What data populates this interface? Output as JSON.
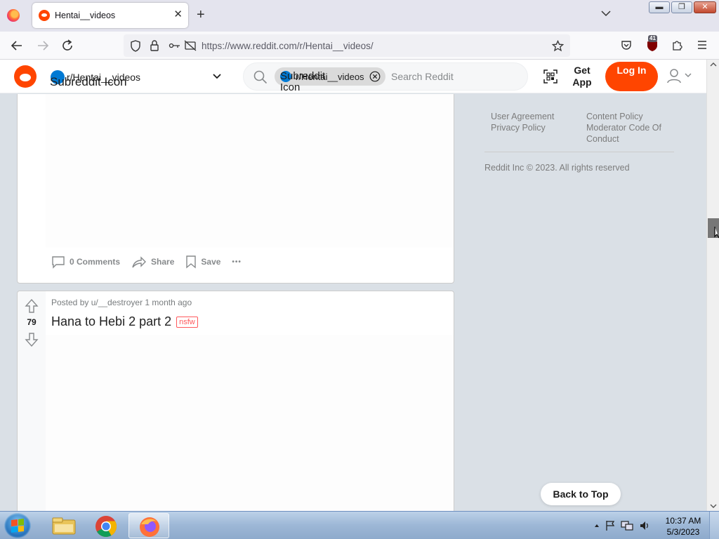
{
  "browser": {
    "tab_title": "Hentai__videos",
    "tab_close": "✕",
    "new_tab": "+",
    "url": "https://www.reddit.com/r/Hentai__videos/",
    "extension_badge": "41",
    "window_controls": {
      "minimize": "▬",
      "maximize": "❐",
      "close": "✕"
    }
  },
  "reddit_header": {
    "community_icon_alt": "Subreddit Icon",
    "community_name": "r/Hentai__videos",
    "search_chip_icon_alt": "Subreddit Icon",
    "search_chip_label": "r/Hentai__videos",
    "search_placeholder": "Search Reddit",
    "get_app_label": "Get App",
    "login_label": "Log In"
  },
  "post1": {
    "actions": {
      "comments_label": "0 Comments",
      "share_label": "Share",
      "save_label": "Save",
      "more_label": "•••"
    }
  },
  "post2": {
    "vote_count": "79",
    "meta": "Posted by u/__destroyer 1 month ago",
    "title": "Hana to Hebi 2 part 2",
    "flair": "nsfw"
  },
  "sidebar": {
    "links": [
      "User Agreement",
      "Content Policy",
      "Privacy Policy",
      "Moderator Code Of Conduct"
    ],
    "copyright": "Reddit Inc © 2023. All rights reserved"
  },
  "back_to_top_label": "Back to Top",
  "colors": {
    "reddit_orange": "#ff4500",
    "reddit_blue": "#0079d3",
    "nsfw_red": "#ff585b",
    "page_bg": "#dae0e6"
  },
  "taskbar": {
    "time": "10:37 AM",
    "date": "5/3/2023",
    "pinned": [
      "windows-explorer-icon",
      "chrome-icon",
      "firefox-icon"
    ]
  }
}
